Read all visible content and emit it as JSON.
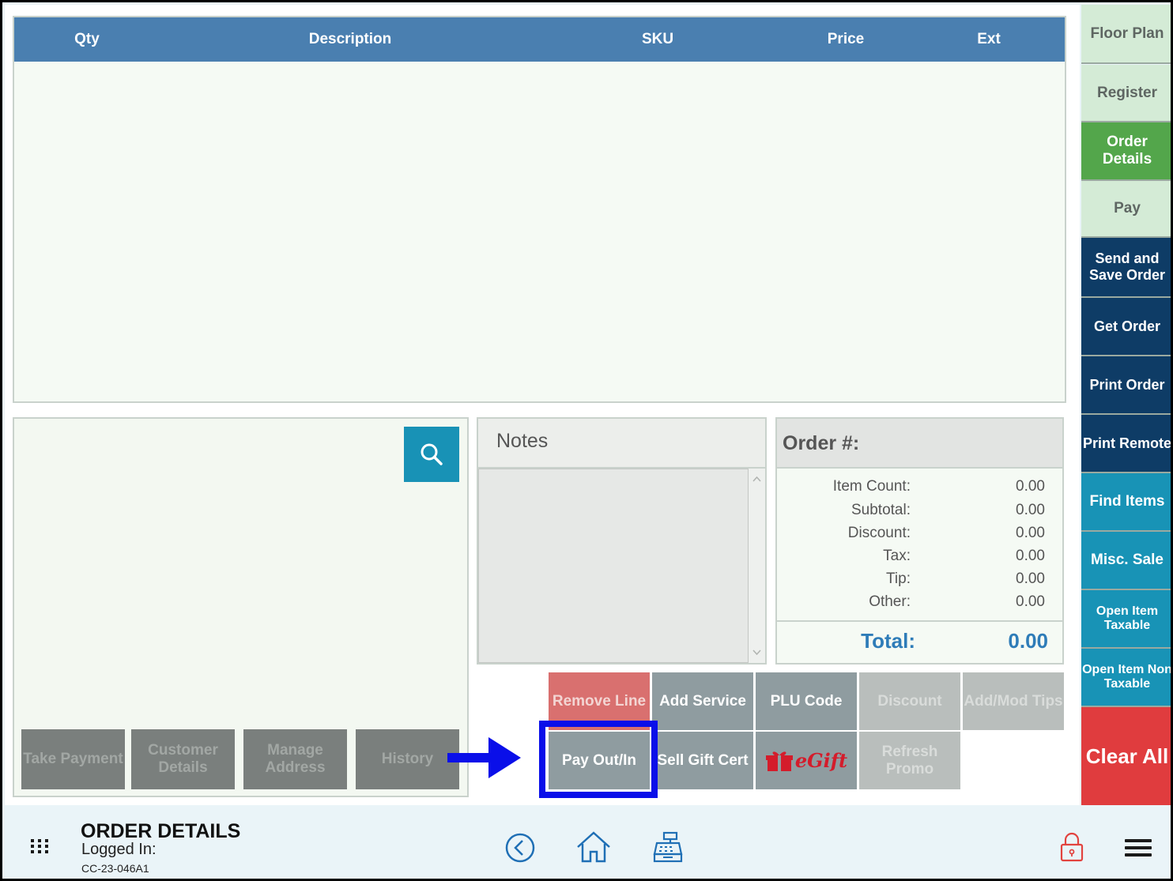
{
  "table": {
    "columns": [
      "Qty",
      "Description",
      "SKU",
      "Price",
      "Ext"
    ]
  },
  "customer": {
    "buttons": [
      "Take Payment",
      "Customer Details",
      "Manage Address",
      "History"
    ]
  },
  "notes": {
    "title": "Notes",
    "value": ""
  },
  "totals": {
    "title": "Order #:",
    "rows": [
      {
        "label": "Item Count:",
        "value": "0.00"
      },
      {
        "label": "Subtotal:",
        "value": "0.00"
      },
      {
        "label": "Discount:",
        "value": "0.00"
      },
      {
        "label": "Tax:",
        "value": "0.00"
      },
      {
        "label": "Tip:",
        "value": "0.00"
      },
      {
        "label": "Other:",
        "value": "0.00"
      }
    ],
    "total_label": "Total:",
    "total_value": "0.00"
  },
  "actions": {
    "remove_line": "Remove Line",
    "add_service": "Add Service",
    "plu_code": "PLU Code",
    "discount": "Discount",
    "add_mod_tips": "Add/Mod Tips",
    "pay_out_in": "Pay Out/In",
    "sell_gift_cert": "Sell Gift Cert",
    "egift": "eGift",
    "refresh_promo": "Refresh Promo"
  },
  "sidebar": {
    "floor_plan": "Floor Plan",
    "register": "Register",
    "order_details": "Order Details",
    "pay": "Pay",
    "send_and_save": "Send and Save Order",
    "get_order": "Get Order",
    "print_order": "Print Order",
    "print_remote": "Print Remote",
    "find_items": "Find Items",
    "misc_sale": "Misc. Sale",
    "open_item_taxable": "Open Item Taxable",
    "open_item_non_taxable": "Open Item Non Taxable",
    "clear_all": "Clear All"
  },
  "footer": {
    "title": "ORDER DETAILS",
    "logged_in": "Logged In:",
    "station": "CC-23-046A1"
  },
  "icons": {
    "search": "search-icon",
    "grid": "grid-menu-icon",
    "back": "back-circle-icon",
    "home": "home-icon",
    "register": "cash-register-icon",
    "lock": "lock-icon",
    "menu": "hamburger-menu-icon",
    "arrow": "arrow-right-icon",
    "gift": "gift-icon"
  },
  "colors": {
    "header_blue": "#4a7fb0",
    "navy": "#0e3c66",
    "teal": "#1893b6",
    "green": "#53a64b",
    "red": "#e03c3e",
    "highlight": "#0a0fe9",
    "total_blue": "#2e7cb8"
  }
}
